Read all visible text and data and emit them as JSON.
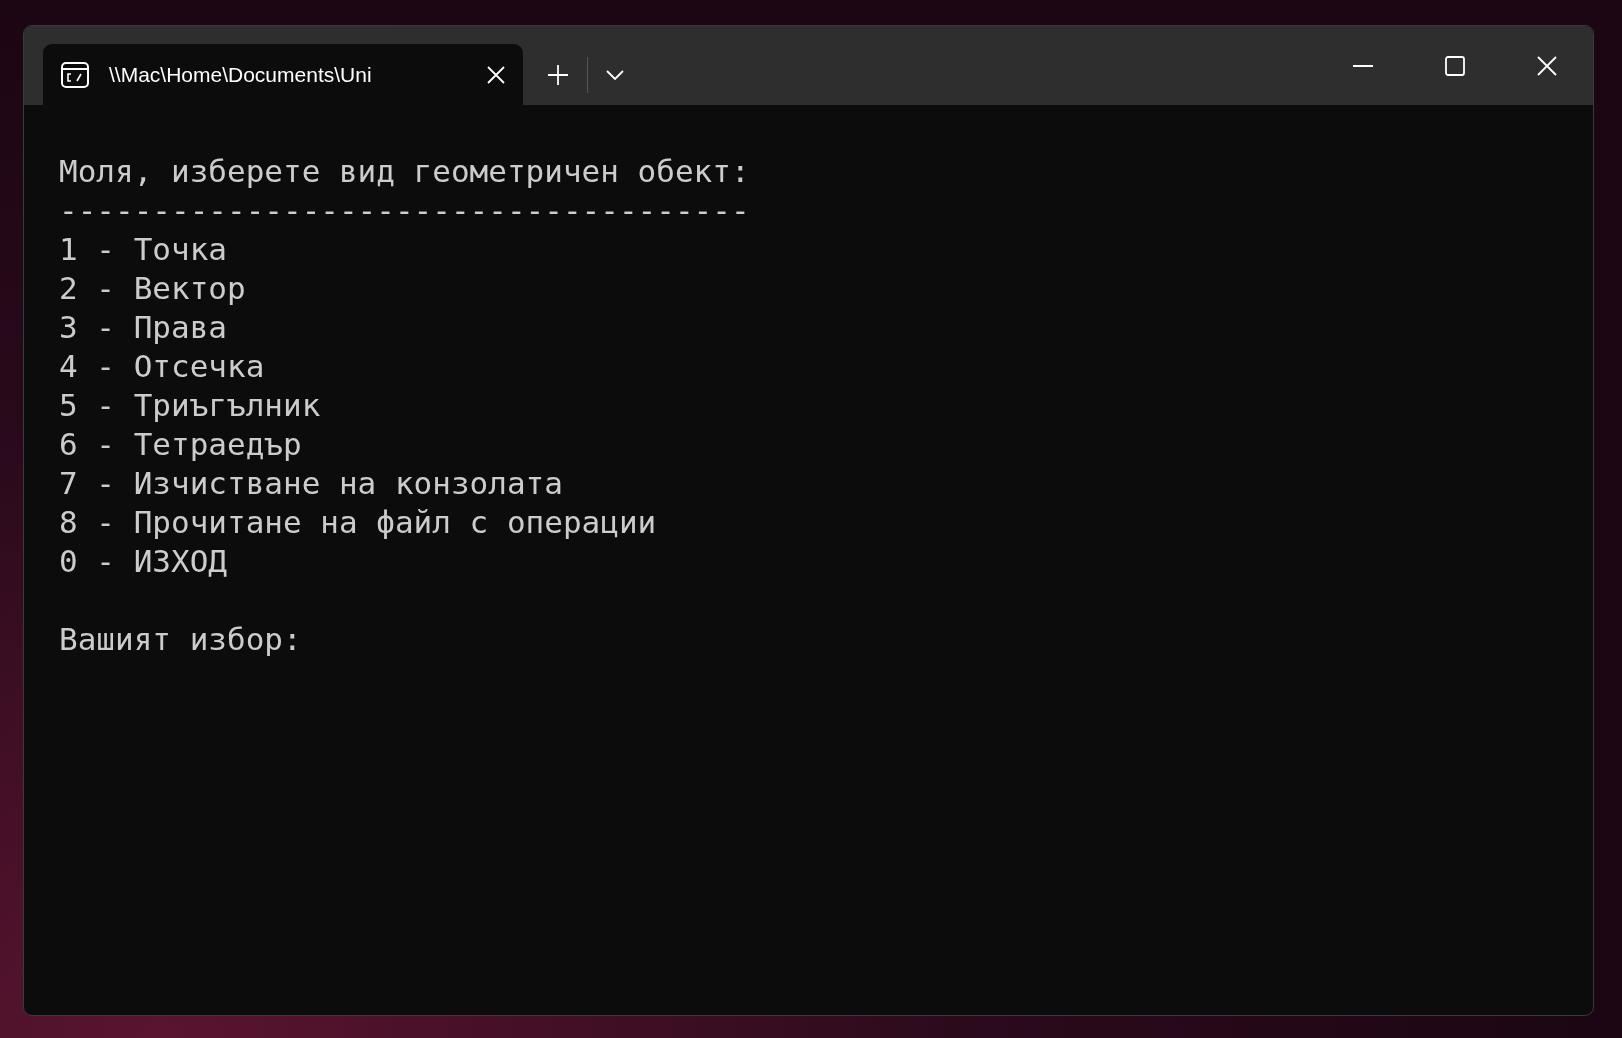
{
  "tabs": [
    {
      "title": "\\\\Mac\\Home\\Documents\\Uni",
      "selected": true
    }
  ],
  "terminal": {
    "lines": [
      {
        "kind": "text",
        "text": "Моля, изберете вид геометричен обект:"
      },
      {
        "kind": "text",
        "text": "-------------------------------------"
      },
      {
        "kind": "text",
        "text": "1 - Точка"
      },
      {
        "kind": "text",
        "text": "2 - Вектор"
      },
      {
        "kind": "text",
        "text": "3 - Права"
      },
      {
        "kind": "text",
        "text": "4 - Отсечка"
      },
      {
        "kind": "text",
        "text": "5 - Триъгълник"
      },
      {
        "kind": "text",
        "text": "6 - Тетраедър"
      },
      {
        "kind": "text",
        "text": "7 - Изчистване на конзолата"
      },
      {
        "kind": "text",
        "text": "8 - Прочитане на файл с операции"
      },
      {
        "kind": "text",
        "text": "0 - ИЗХОД"
      },
      {
        "kind": "blank"
      },
      {
        "kind": "text",
        "text": "Вашият избор:"
      }
    ]
  }
}
